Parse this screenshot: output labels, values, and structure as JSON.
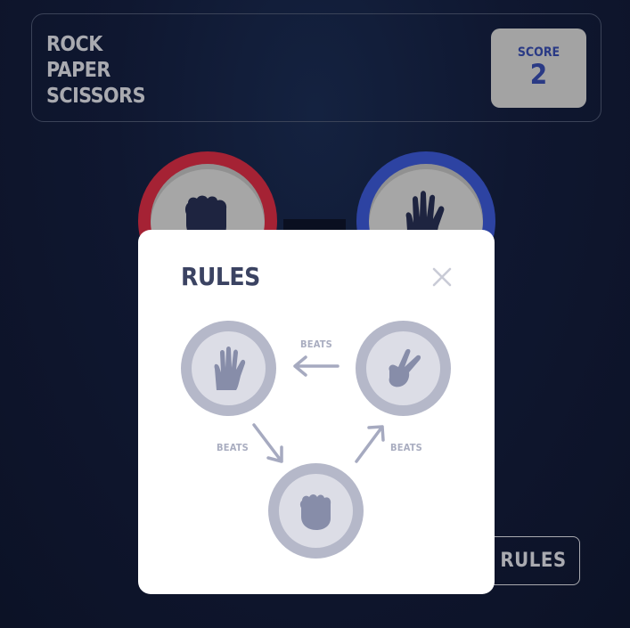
{
  "header": {
    "title_lines": [
      "ROCK",
      "PAPER",
      "SCISSORS"
    ],
    "score_label": "SCORE",
    "score_value": "2"
  },
  "game": {
    "player_pick": "rock",
    "house_pick": "paper",
    "colors": {
      "rock_ring": "#a52234",
      "paper_ring": "#2d43a2"
    }
  },
  "rules_button": {
    "label": "RULES"
  },
  "modal": {
    "title": "RULES",
    "close_icon": "close-icon",
    "beats_labels": [
      "BEATS",
      "BEATS",
      "BEATS"
    ],
    "diagram": [
      "paper-icon",
      "scissors-icon",
      "rock-icon"
    ]
  }
}
